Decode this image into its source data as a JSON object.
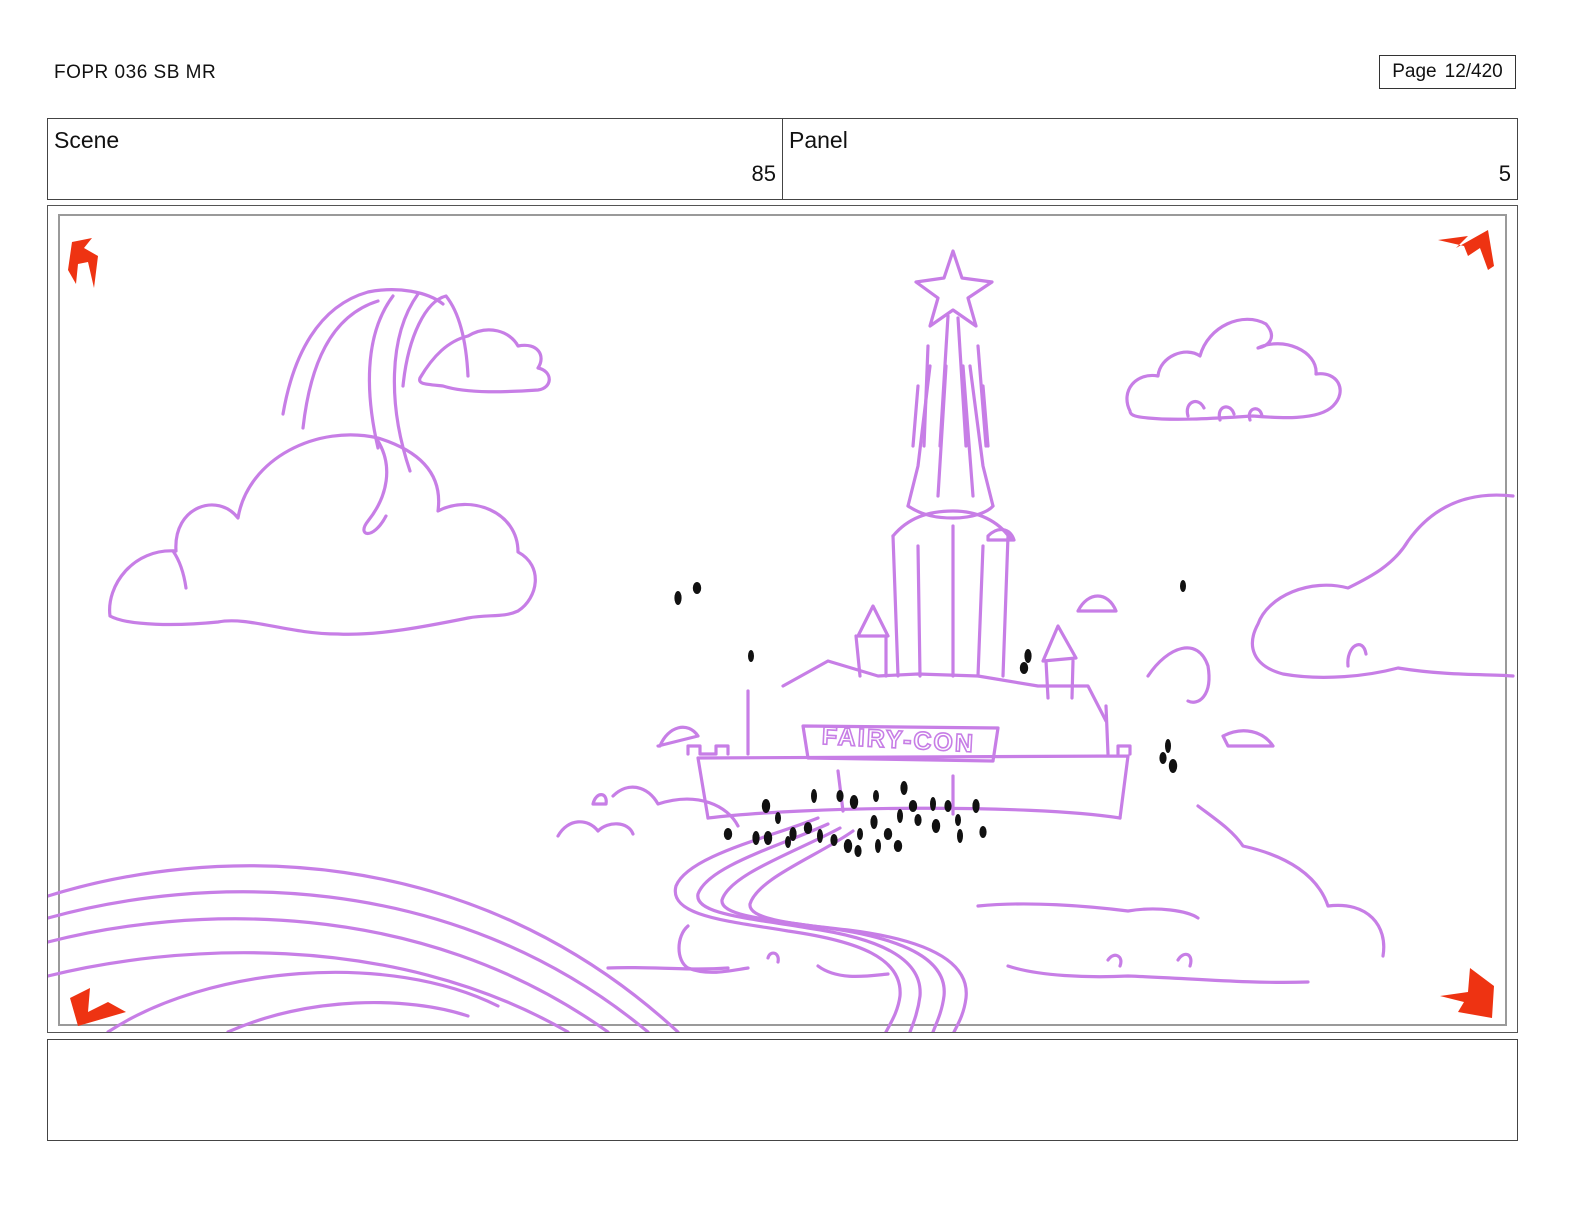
{
  "header": {
    "doc_id": "FOPR 036 SB MR",
    "page_label": "Page",
    "page_number": "12/420"
  },
  "panel_info": {
    "scene_label": "Scene",
    "scene_value": "85",
    "panel_label": "Panel",
    "panel_value": "5"
  },
  "artwork": {
    "banner_text": "FAIRY-CON",
    "sketch_color": "#c77ee6",
    "corner_marker_color": "#ee3312",
    "crowd_color": "#111111"
  },
  "notes": {
    "text": ""
  }
}
